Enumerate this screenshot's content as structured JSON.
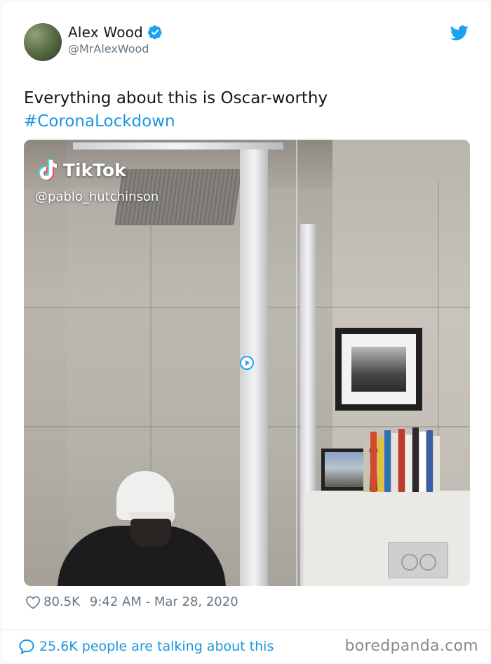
{
  "author": {
    "name": "Alex Wood",
    "handle": "@MrAlexWood",
    "verified_icon": "verified-badge-icon",
    "platform_icon": "twitter-bird-icon"
  },
  "tweet": {
    "text": "Everything about this is Oscar-worthy",
    "hashtag": "#CoronaLockdown"
  },
  "media": {
    "watermark_brand": "TikTok",
    "watermark_user": "@pablo_hutchinson",
    "play_icon": "play-icon"
  },
  "footer": {
    "likes": "80.5K",
    "timestamp": "9:42 AM - Mar 28, 2020",
    "talking": "25.6K people are talking about this",
    "site_watermark": "boredpanda.com"
  },
  "colors": {
    "link": "#1b95e0",
    "text": "#14171a",
    "muted": "#657786",
    "border": "#e1e8ed"
  }
}
